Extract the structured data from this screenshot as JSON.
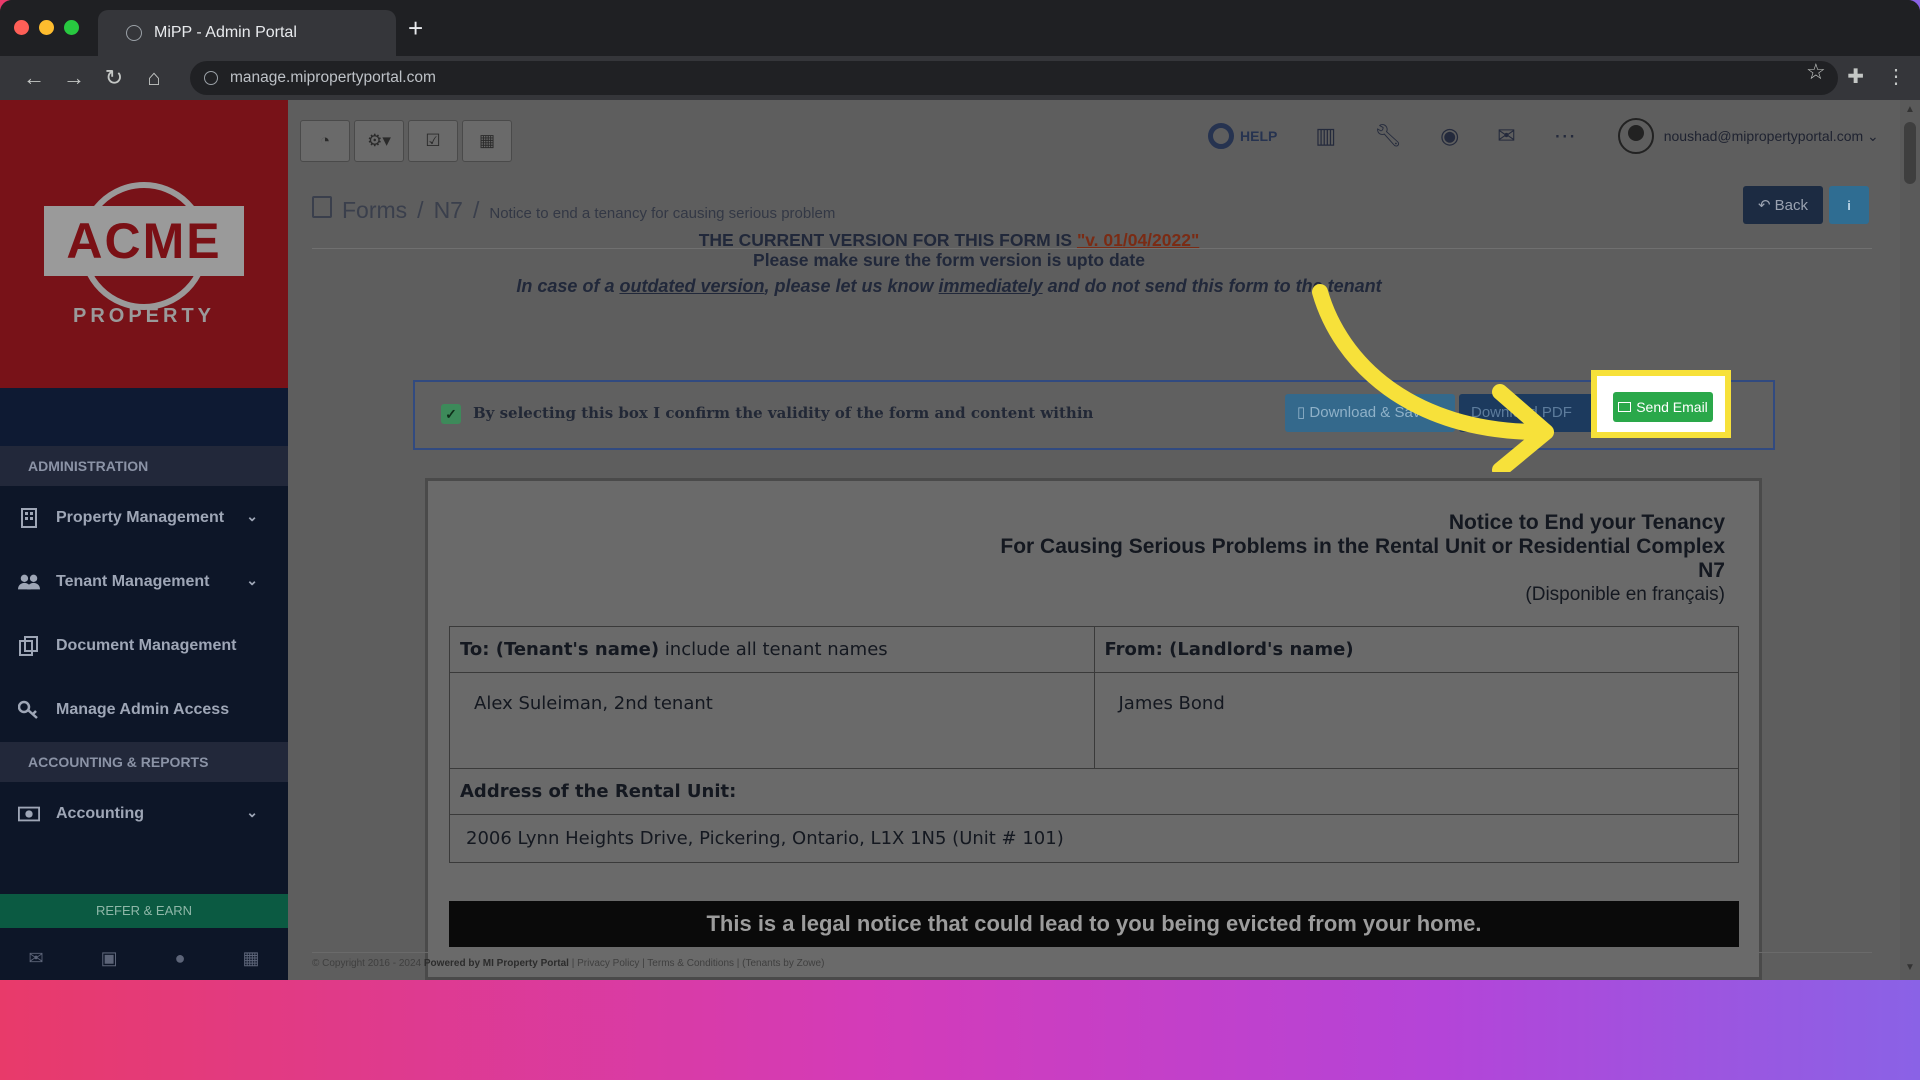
{
  "browser": {
    "tab_title": "MiPP - Admin Portal",
    "url": "manage.mipropertyportal.com"
  },
  "sidebar": {
    "logo_text": "ACME",
    "logo_subtext": "PROPERTY",
    "sections": [
      {
        "header": "ADMINISTRATION",
        "items": [
          {
            "label": "Property Management",
            "icon": "building-icon",
            "expandable": true
          },
          {
            "label": "Tenant Management",
            "icon": "users-icon",
            "expandable": true
          },
          {
            "label": "Document Management",
            "icon": "documents-icon",
            "expandable": false
          },
          {
            "label": "Manage Admin Access",
            "icon": "key-icon",
            "expandable": false
          }
        ]
      },
      {
        "header": "ACCOUNTING & REPORTS",
        "items": [
          {
            "label": "Accounting",
            "icon": "money-icon",
            "expandable": true
          }
        ]
      }
    ],
    "refer_label": "REFER & EARN"
  },
  "topbar": {
    "help_label": "HELP",
    "user_email": "noushad@mipropertyportal.com"
  },
  "breadcrumb": {
    "forms": "Forms",
    "sep": "/",
    "form_code": "N7",
    "current": "Notice to end a tenancy for causing serious problem"
  },
  "actions": {
    "back_label": "Back",
    "info_label": "i"
  },
  "version_notice": {
    "line1_prefix": "THE CURRENT VERSION FOR THIS FORM IS ",
    "version": "\"v. 01/04/2022\"",
    "line2": "Please make sure the form version is upto date",
    "warning_part1": "In case of a ",
    "warning_link1": "outdated version",
    "warning_part2": ", please let us know ",
    "warning_link2": "immediately",
    "warning_part3": " and do not send this form to the tenant"
  },
  "confirm": {
    "checked": true,
    "label": "By selecting this box I confirm the validity of the form and content within",
    "download_save_label": "Download & Save",
    "download_pdf_label": "Download PDF",
    "send_email_label": "Send Email"
  },
  "document": {
    "title1": "Notice to End your Tenancy",
    "title2": "For Causing Serious Problems in the Rental Unit or Residential Complex",
    "title3": "N7",
    "title4": "(Disponible en français)",
    "to_label_bold": "To: (Tenant's name)",
    "to_label_rest": " include all tenant names",
    "from_label": "From: (Landlord's name)",
    "tenant_name": "Alex Suleiman, 2nd  tenant",
    "landlord_name": "James Bond",
    "address_label": "Address of the Rental Unit:",
    "address_value": "2006 Lynn Heights Drive, Pickering, Ontario, L1X 1N5 (Unit # 101)",
    "legal_banner": "This is a legal notice that could lead to you being evicted from your home."
  },
  "footer": {
    "copyright": "© Copyright 2016 - 2024 ",
    "powered": "Powered by MI Property Portal",
    "links": " | Privacy Policy | Terms & Conditions | ",
    "tenants": "(Tenants by Zowe)"
  },
  "colors": {
    "highlight": "#f7e13a",
    "send_button": "#2aa84a",
    "sidebar_bg": "#0d1628",
    "logo_bg": "#781218"
  }
}
